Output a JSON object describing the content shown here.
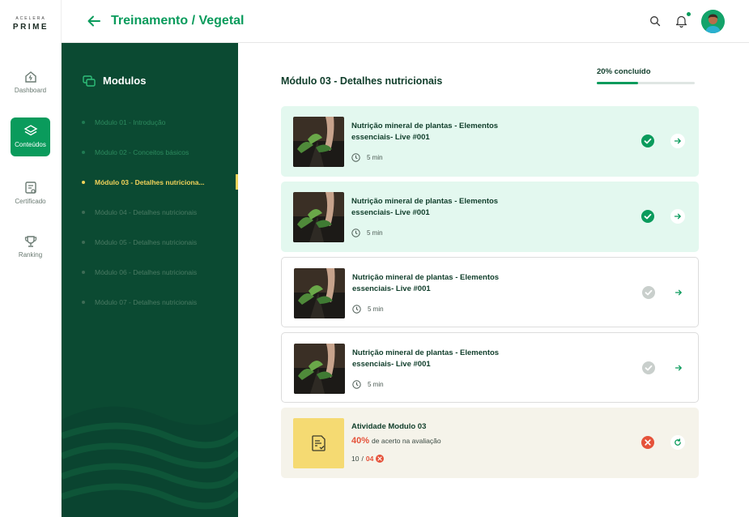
{
  "brand": {
    "top": "ACELERA",
    "name": "PRIME"
  },
  "nav": [
    {
      "label": "Dashboard",
      "icon": "home-icon",
      "active": false
    },
    {
      "label": "Conteúdos",
      "icon": "layers-icon",
      "active": true
    },
    {
      "label": "Certificado",
      "icon": "certificate-icon",
      "active": false
    },
    {
      "label": "Ranking",
      "icon": "trophy-icon",
      "active": false
    }
  ],
  "header": {
    "title": "Treinamento / Vegetal"
  },
  "sidebar": {
    "title": "Modulos",
    "modules": [
      {
        "label": "Módulo 01 - Introdução",
        "state": "done"
      },
      {
        "label": "Módulo 02 - Conceitos básicos",
        "state": "done"
      },
      {
        "label": "Módulo 03 - Detalhes nutriciona...",
        "state": "active"
      },
      {
        "label": "Módulo 04 - Detalhes nutricionais",
        "state": "locked"
      },
      {
        "label": "Módulo 05 - Detalhes nutricionais",
        "state": "locked"
      },
      {
        "label": "Módulo 06 - Detalhes nutricionais",
        "state": "locked"
      },
      {
        "label": "Módulo 07 - Detalhes nutricionais",
        "state": "locked"
      }
    ]
  },
  "main": {
    "title": "Módulo 03 - Detalhes nutricionais",
    "progress_label": "20% concluído",
    "progress_fraction": 0.42,
    "lessons": [
      {
        "title": "Nutrição mineral de plantas - Elementos essenciais- Live #001",
        "duration": "5 min",
        "status": "completed"
      },
      {
        "title": "Nutrição mineral de plantas - Elementos essenciais- Live #001",
        "duration": "5 min",
        "status": "completed"
      },
      {
        "title": "Nutrição mineral de plantas - Elementos essenciais- Live #001",
        "duration": "5 min",
        "status": "pending"
      },
      {
        "title": "Nutrição mineral de plantas - Elementos essenciais- Live #001",
        "duration": "5 min",
        "status": "pending"
      }
    ],
    "activity": {
      "title": "Atividade Modulo 03",
      "score": "40%",
      "score_text": "de acerto na avaliação",
      "count_total": "10",
      "count_sep": " / ",
      "count_wrong": "04"
    }
  },
  "colors": {
    "primary": "#0a9b5c",
    "dark_green": "#0b4a32",
    "accent_yellow": "#f2d35a",
    "error": "#e5523a"
  }
}
